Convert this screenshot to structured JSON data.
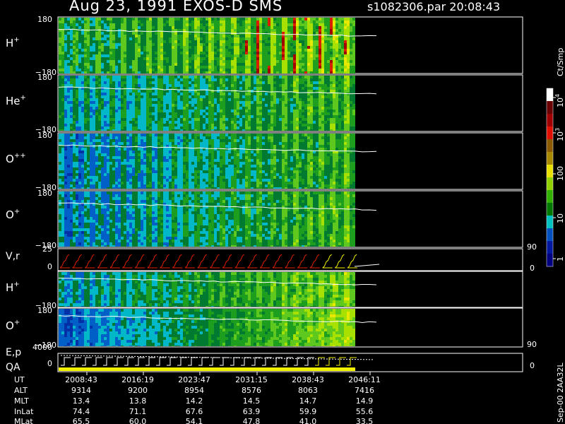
{
  "header": {
    "title": "Aug 23, 1991    EXOS-D SMS",
    "file": "s1082306.par  20:08:43"
  },
  "chart_data": {
    "type": "heatmap",
    "panels": [
      {
        "key": "h1",
        "label": "H",
        "sup": "+",
        "ymax": "180",
        "ymin": "−180",
        "base": {
          "start": 4.5,
          "end": 6.6
        },
        "amp": 1.5,
        "bright_red": true
      },
      {
        "key": "he",
        "label": "He",
        "sup": "+",
        "ymax": "180",
        "ymin": "−180",
        "base": {
          "start": 3.4,
          "end": 5.5
        },
        "amp": 1.3,
        "bright_red": false
      },
      {
        "key": "opp",
        "label": "O",
        "sup": "++",
        "ymax": "180",
        "ymin": "−180",
        "base": {
          "start": 2.6,
          "end": 5.5
        },
        "amp": 1.2,
        "bright_red": false
      },
      {
        "key": "o1",
        "label": "O",
        "sup": "+",
        "ymax": "180",
        "ymin": "−180",
        "base": {
          "start": 2.6,
          "end": 5.7
        },
        "amp": 1.2,
        "bright_red": false
      },
      {
        "key": "h2",
        "label": "H",
        "sup": "+",
        "ymax": "",
        "ymin": "−180",
        "base": {
          "start": 3.0,
          "end": 6.4
        },
        "amp": 1.0,
        "bright_red": false
      },
      {
        "key": "o2",
        "label": "O",
        "sup": "+",
        "ymax": "180",
        "ymin": "−180",
        "base": {
          "start": 1.8,
          "end": 7.0
        },
        "amp": 0.6,
        "bright_red": false
      }
    ],
    "vr_panel": {
      "label": "V,r",
      "ytop": "25",
      "ybottom": "0",
      "right_top": "90",
      "right_bottom": "0"
    },
    "ep_panel": {
      "label1": "E,p",
      "label2": "QA",
      "ytop": "4000",
      "ybottom": "0",
      "right_top": "90",
      "right_bottom": "0"
    },
    "colorbar": {
      "unit": "Ct/Smp",
      "tick_labels": [
        "10",
        "4",
        "10",
        "3",
        "100",
        "10",
        "1"
      ],
      "colors": [
        "#ffffff",
        "#6a0000",
        "#a00000",
        "#e01000",
        "#8c5a00",
        "#a88800",
        "#e8e000",
        "#90d000",
        "#30b000",
        "#007800",
        "#00c0c0",
        "#0050c0",
        "#0018a0",
        "#000080"
      ]
    },
    "time_axis": {
      "rows": [
        {
          "name": "UT",
          "values": [
            "2008:43",
            "2016:19",
            "2023:47",
            "2031:15",
            "2038:43",
            "2046:11"
          ]
        },
        {
          "name": "ALT",
          "values": [
            "9314",
            "9200",
            "8954",
            "8576",
            "8063",
            "7416"
          ]
        },
        {
          "name": "MLT",
          "values": [
            "13.4",
            "13.8",
            "14.2",
            "14.5",
            "14.7",
            "14.9"
          ]
        },
        {
          "name": "InLat",
          "values": [
            "74.4",
            "71.1",
            "67.6",
            "63.9",
            "59.9",
            "55.6"
          ]
        },
        {
          "name": "MLat",
          "values": [
            "65.5",
            "60.0",
            "54.1",
            "47.8",
            "41.0",
            "33.5"
          ]
        }
      ]
    },
    "side_label": "Sep-00  2AA32L"
  }
}
